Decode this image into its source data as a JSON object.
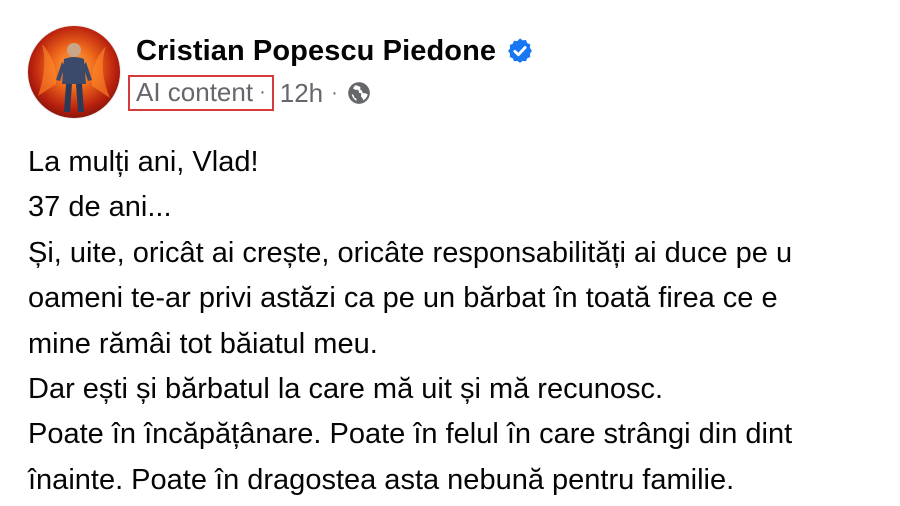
{
  "post": {
    "author": {
      "name": "Cristian Popescu Piedone",
      "avatar_icon": "profile-photo",
      "verified": true,
      "verified_icon": "verified-badge-icon",
      "verified_color": "#1877f2"
    },
    "meta": {
      "ai_label": "AI content",
      "separator": "·",
      "timestamp": "12h",
      "audience_icon": "globe-icon",
      "highlight_color": "#d63a3a"
    },
    "text_lines": [
      "La mulți ani, Vlad!",
      "37 de ani...",
      "Și, uite, oricât ai crește, oricâte responsabilități ai duce pe u",
      "oameni te-ar privi astăzi ca pe un bărbat în toată firea ce e",
      "mine rămâi tot băiatul meu.",
      "Dar ești și bărbatul la care mă uit și mă recunosc.",
      "Poate în încăpățânare. Poate în felul în care strângi din dint",
      "înainte. Poate în dragostea asta nebună pentru familie."
    ]
  }
}
